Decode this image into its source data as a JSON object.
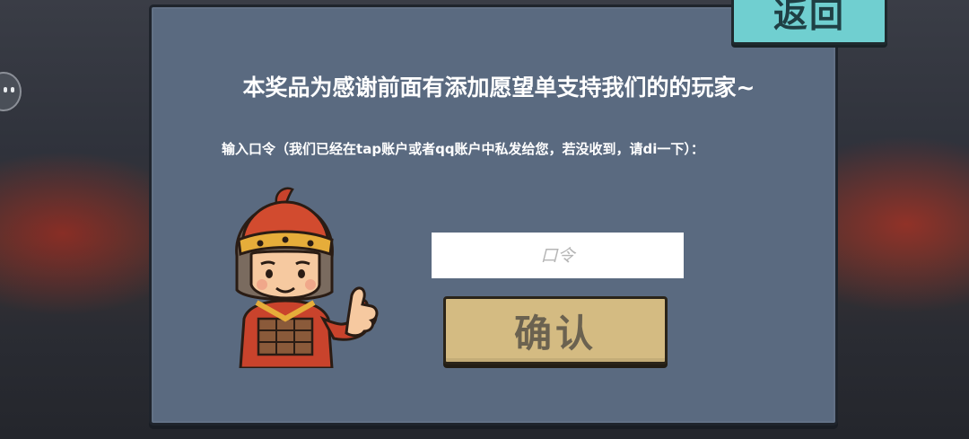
{
  "header": {
    "back_label": "返回"
  },
  "dialog": {
    "title": "本奖品为感谢前面有添加愿望单支持我们的的玩家~",
    "instruction": "输入口令（我们已经在tap账户或者qq账户中私发给您，若没收到，请di一下）："
  },
  "form": {
    "code_placeholder": "口令",
    "code_value": "",
    "confirm_label": "确认"
  },
  "colors": {
    "panel": "#5a6a80",
    "back_button": "#70cfd0",
    "confirm_button": "#d4bb82"
  },
  "icons": {
    "mascot": "warrior-thumbs-up-icon"
  }
}
